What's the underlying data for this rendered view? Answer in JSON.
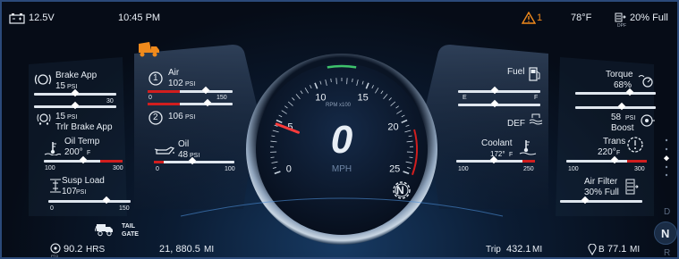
{
  "status_bar": {
    "battery_voltage": "12.5V",
    "clock": "10:45 PM",
    "warning_count": "1",
    "outside_temp": "78°F",
    "dpf_label": "DPF",
    "dpf_fill": "20% Full"
  },
  "left_panel": {
    "brake_app": {
      "label": "Brake App",
      "value": "15",
      "unit": "PSI",
      "scale_max": "30",
      "level": 0.5
    },
    "trlr_brake_app": {
      "label": "Trlr Brake App",
      "value": "15",
      "unit": "PSI"
    },
    "oil_temp": {
      "label": "Oil Temp",
      "value": "200°",
      "unit": "F",
      "scale_min": "100",
      "scale_max": "300",
      "level": 0.5
    },
    "susp_load": {
      "label": "Susp Load",
      "value": "107",
      "unit": "PSI",
      "scale_min": "0",
      "scale_max": "150",
      "level": 0.71
    },
    "tail_gate": {
      "line1": "TAIL",
      "line2": "GATE"
    }
  },
  "center_left": {
    "air1": {
      "badge": "1",
      "label": "Air",
      "value": "102",
      "unit": "PSI",
      "level": 0.68
    },
    "air2": {
      "badge": "2",
      "value": "106",
      "unit": "PSI",
      "level": 0.71
    },
    "air_scale_min": "0",
    "air_scale_max": "150",
    "oil": {
      "label": "Oil",
      "value": "48",
      "unit": "PSI",
      "scale_min": "0",
      "scale_max": "100",
      "level": 0.48
    }
  },
  "speedometer": {
    "speed": "0",
    "speed_unit": "MPH",
    "rpm_unit": "RPM x100",
    "ticks": [
      "0",
      "5",
      "10",
      "15",
      "20",
      "25"
    ],
    "gear": "N"
  },
  "center_right": {
    "fuel": {
      "label": "Fuel",
      "empty": "E",
      "full": "F",
      "level": 0.45
    },
    "def": {
      "label": "DEF",
      "empty": "E",
      "full": "F",
      "level": 0.45
    },
    "coolant": {
      "label": "Coolant",
      "value": "172°",
      "unit": "F",
      "scale_min": "100",
      "scale_max": "250",
      "level": 0.48
    }
  },
  "right_panel": {
    "torque": {
      "label": "Torque",
      "value": "68%",
      "level": 0.68
    },
    "boost": {
      "label": "Boost",
      "value": "58",
      "unit": "PSI",
      "level": 0.58
    },
    "trans": {
      "label": "Trans",
      "value": "220°",
      "unit": "F",
      "scale_min": "100",
      "scale_max": "300",
      "level": 0.6
    },
    "air_filter": {
      "label": "Air Filter",
      "value": "30% Full",
      "level": 0.3
    }
  },
  "gear_selector": {
    "upper": "D",
    "current": "N",
    "lower": "R"
  },
  "bottom_bar": {
    "pto_label": "PTO",
    "pto_hours": "90.2",
    "pto_hours_unit": "HRS",
    "odometer": "21, 880.5",
    "odometer_unit": "MI",
    "trip_label": "Trip",
    "trip_value": "432.1",
    "trip_unit": "MI",
    "range_label": "B",
    "range_value": "77.1",
    "range_unit": "MI"
  },
  "colors": {
    "accent_red": "#d11e1e",
    "warning_orange": "#f08a1c",
    "frame_blue": "#2b4a7a",
    "rpm_green": "#3ec36b"
  }
}
